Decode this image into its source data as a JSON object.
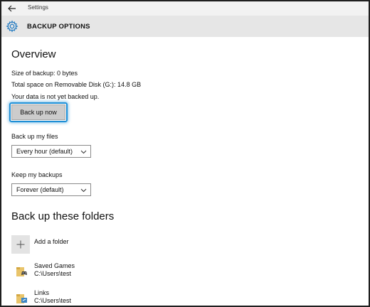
{
  "window": {
    "title": "Settings"
  },
  "header": {
    "title": "BACKUP OPTIONS"
  },
  "overview": {
    "heading": "Overview",
    "size_of_backup": "Size of backup: 0 bytes",
    "total_space": "Total space on Removable Disk (G:): 14.8 GB",
    "status": "Your data is not yet backed up.",
    "backup_button": "Back up now"
  },
  "backup_files": {
    "label": "Back up my files",
    "selected": "Every hour (default)"
  },
  "keep_backups": {
    "label": "Keep my backups",
    "selected": "Forever (default)"
  },
  "folders": {
    "heading": "Back up these folders",
    "add_label": "Add a folder",
    "items": [
      {
        "name": "Saved Games",
        "path": "C:\\Users\\test",
        "icon": "saved-games-folder-icon"
      },
      {
        "name": "Links",
        "path": "C:\\Users\\test",
        "icon": "links-folder-icon"
      }
    ]
  },
  "colors": {
    "accent": "#1e8fd6",
    "header_bg": "#e6e6e6",
    "button_bg": "#cccccc"
  }
}
